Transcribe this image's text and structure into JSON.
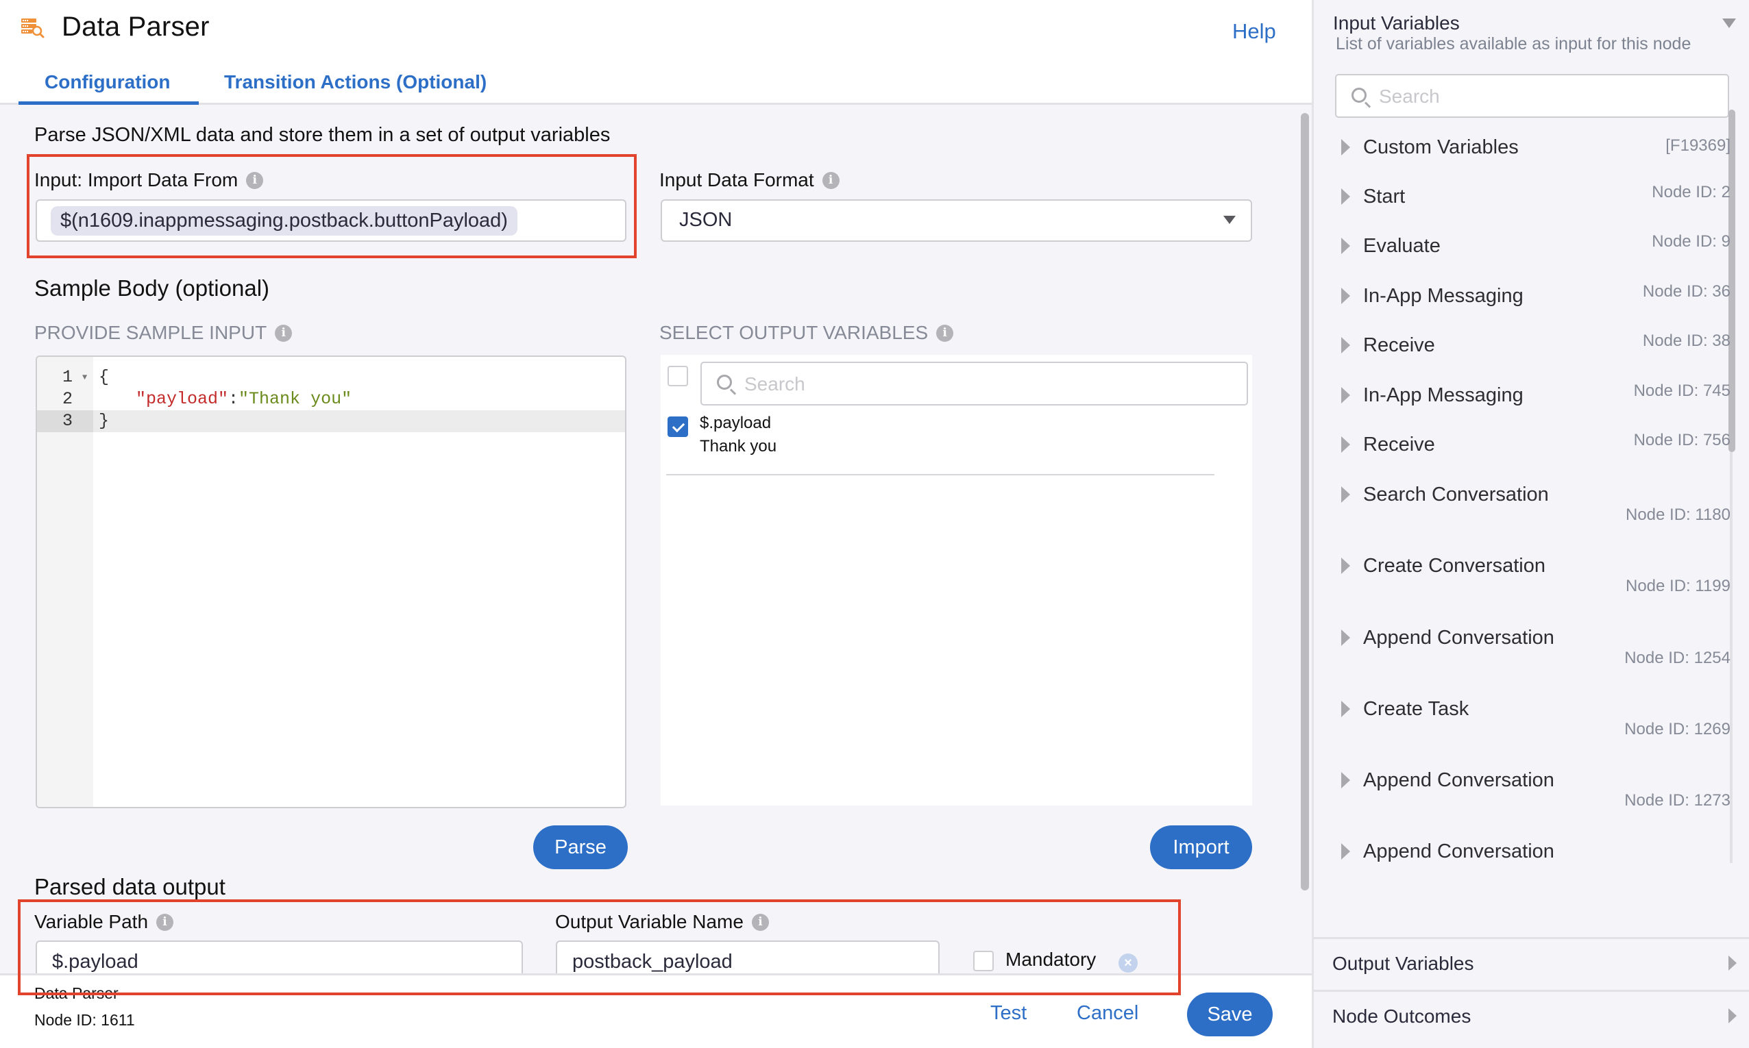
{
  "header": {
    "icon": "data-parser-icon",
    "title": "Data Parser",
    "help_label": "Help",
    "tabs": [
      {
        "label": "Configuration",
        "active": true
      },
      {
        "label": "Transition Actions (Optional)",
        "active": false
      }
    ]
  },
  "config": {
    "description": "Parse JSON/XML data and store them in a set of output variables",
    "import_label": "Input: Import Data From",
    "import_value": "$(n1609.inappmessaging.postback.buttonPayload)",
    "format_label": "Input Data Format",
    "format_value": "JSON",
    "sample_body_title": "Sample Body (optional)",
    "sample_input_label": "PROVIDE SAMPLE INPUT",
    "code_lines": [
      {
        "number": "1",
        "text": "{"
      },
      {
        "number": "2",
        "key": "\"payload\"",
        "sep": ":",
        "value": "\"Thank you\""
      },
      {
        "number": "3",
        "text": "}"
      }
    ],
    "select_output_label": "SELECT OUTPUT VARIABLES",
    "output_search_placeholder": "Search",
    "output_vars": [
      {
        "path": "$.payload",
        "value": "Thank you",
        "checked": true
      }
    ],
    "parse_label": "Parse",
    "import_button_label": "Import",
    "parsed_output_title": "Parsed data output",
    "variable_path_label": "Variable Path",
    "output_var_name_label": "Output Variable Name",
    "parsed_rows": [
      {
        "variable_path": "$.payload",
        "output_name": "postback_payload",
        "mandatory_label": "Mandatory",
        "mandatory": false
      }
    ]
  },
  "footer": {
    "node_name": "Data Parser",
    "node_id": "Node ID: 1611",
    "test_label": "Test",
    "cancel_label": "Cancel",
    "save_label": "Save"
  },
  "right_panel": {
    "title": "Input Variables",
    "subtitle": "List of variables available as input for this node",
    "search_placeholder": "Search",
    "items": [
      {
        "name": "Custom Variables",
        "id": "[F19369]"
      },
      {
        "name": "Start",
        "id": "Node ID: 2"
      },
      {
        "name": "Evaluate",
        "id": "Node ID: 9"
      },
      {
        "name": "In-App Messaging",
        "id": "Node ID: 36"
      },
      {
        "name": "Receive",
        "id": "Node ID: 38"
      },
      {
        "name": "In-App Messaging",
        "id": "Node ID: 745"
      },
      {
        "name": "Receive",
        "id": "Node ID: 756"
      },
      {
        "name": "Search Conversation",
        "id": "Node ID: 1180"
      },
      {
        "name": "Create Conversation",
        "id": "Node ID: 1199"
      },
      {
        "name": "Append Conversation",
        "id": "Node ID: 1254"
      },
      {
        "name": "Create Task",
        "id": "Node ID: 1269"
      },
      {
        "name": "Append Conversation",
        "id": "Node ID: 1273"
      },
      {
        "name": "Append Conversation",
        "id": ""
      }
    ],
    "sections": [
      {
        "label": "Output Variables"
      },
      {
        "label": "Node Outcomes"
      }
    ]
  },
  "colors": {
    "accent": "#2d6fc7",
    "highlight_border": "#e2432c",
    "icon_orange": "#f0913a"
  }
}
